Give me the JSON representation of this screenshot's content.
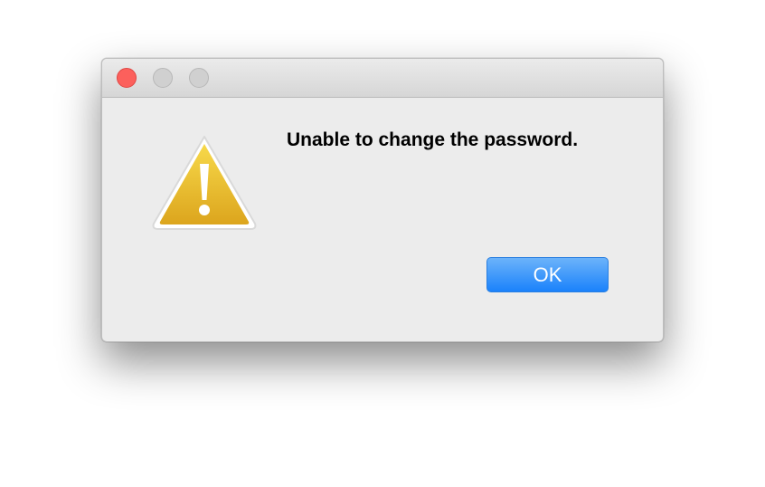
{
  "dialog": {
    "message": "Unable to change the password.",
    "icon": "warning-icon",
    "ok_label": "OK"
  },
  "window_controls": [
    "close",
    "minimize",
    "maximize"
  ],
  "colors": {
    "close_light": "#fc605c",
    "inactive_light": "#d0d0d0",
    "button_blue": "#1a82fb",
    "window_bg": "#ececec",
    "warning_yellow": "#f1c40f"
  }
}
